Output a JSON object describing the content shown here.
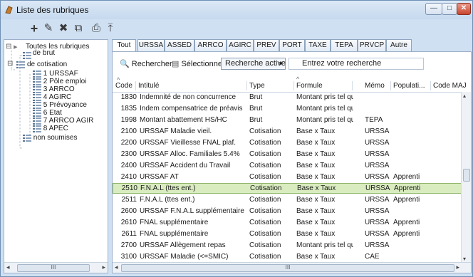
{
  "window": {
    "title": "Liste des rubriques",
    "min_icon": "—",
    "max_icon": "□",
    "close_icon": "✕"
  },
  "toolbar": [
    {
      "name": "add-icon",
      "glyph": "+"
    },
    {
      "name": "edit-icon",
      "glyph": "✎"
    },
    {
      "name": "delete-icon",
      "glyph": "✖"
    },
    {
      "name": "duplicate-icon",
      "glyph": "⧉"
    },
    {
      "name": "print-icon",
      "glyph": "⎙"
    },
    {
      "name": "export-icon",
      "glyph": "⤒"
    }
  ],
  "tree": {
    "expander_open": "⊟",
    "root": "Toutes les rubriques",
    "brut": "de brut",
    "cotisation": "de cotisation",
    "children": [
      "1 URSSAF",
      "2 Pôle emploi",
      "3 ARRCO",
      "4 AGIRC",
      "5 Prévoyance",
      "6 Etat",
      "7 ARRCO AGIR",
      "8 APEC"
    ],
    "non_soumises": "non soumises",
    "scroll_thumb": "III",
    "scroll_left": "◂",
    "scroll_right": "▸"
  },
  "tabs": [
    "Tout",
    "URSSA",
    "ASSED",
    "ARRCO",
    "AGIRC",
    "PREV",
    "PORT",
    "TAXE",
    "TEPA",
    "PRVCP",
    "Autre"
  ],
  "search": {
    "rechercher": "Rechercher",
    "selectionner": "Sélectionner",
    "mode": "Recherche active",
    "placeholder": "Entrez votre recherche",
    "dropdown_arrow": "▼",
    "search_glyph": "🔍",
    "select_glyph": "▤"
  },
  "columns": [
    "Code",
    "Intitulé",
    "Type",
    "Formule",
    "Mémo",
    "Populati...",
    "Code MAJ"
  ],
  "sort_indicator": "^",
  "rows": [
    {
      "code": "1830",
      "intitule": "Indemnité de non concurrence",
      "type": "Brut",
      "formule": "Montant pris tel quel",
      "memo": "",
      "population": "",
      "code_maj": ""
    },
    {
      "code": "1835",
      "intitule": "Indem compensatrice de préavis",
      "type": "Brut",
      "formule": "Montant pris tel quel",
      "memo": "",
      "population": "",
      "code_maj": ""
    },
    {
      "code": "1998",
      "intitule": "Montant abattement HS/HC",
      "type": "Brut",
      "formule": "Montant pris tel quel",
      "memo": "TEPA",
      "population": "",
      "code_maj": ""
    },
    {
      "code": "2100",
      "intitule": "URSSAF Maladie vieil.",
      "type": "Cotisation",
      "formule": "Base x Taux",
      "memo": "URSSA",
      "population": "",
      "code_maj": ""
    },
    {
      "code": "2200",
      "intitule": "URSSAF Vieillesse FNAL plaf.",
      "type": "Cotisation",
      "formule": "Base x Taux",
      "memo": "URSSA",
      "population": "",
      "code_maj": ""
    },
    {
      "code": "2300",
      "intitule": "URSSAF Alloc. Familiales 5.4%",
      "type": "Cotisation",
      "formule": "Base x Taux",
      "memo": "URSSA",
      "population": "",
      "code_maj": ""
    },
    {
      "code": "2400",
      "intitule": "URSSAF Accident du Travail",
      "type": "Cotisation",
      "formule": "Base x Taux",
      "memo": "URSSA",
      "population": "",
      "code_maj": ""
    },
    {
      "code": "2410",
      "intitule": "URSSAF AT",
      "type": "Cotisation",
      "formule": "Base x Taux",
      "memo": "URSSA",
      "population": "Apprenti",
      "code_maj": ""
    },
    {
      "code": "2510",
      "intitule": "F.N.A.L (ttes ent.)",
      "type": "Cotisation",
      "formule": "Base x Taux",
      "memo": "URSSA",
      "population": "Apprenti",
      "code_maj": ""
    },
    {
      "code": "2511",
      "intitule": "F.N.A.L (ttes ent.)",
      "type": "Cotisation",
      "formule": "Base x Taux",
      "memo": "URSSA",
      "population": "Apprenti",
      "code_maj": ""
    },
    {
      "code": "2600",
      "intitule": "URSSAF F.N.A.L supplémentaire",
      "type": "Cotisation",
      "formule": "Base x Taux",
      "memo": "URSSA",
      "population": "",
      "code_maj": ""
    },
    {
      "code": "2610",
      "intitule": "FNAL supplémentaire",
      "type": "Cotisation",
      "formule": "Base x Taux",
      "memo": "URSSA",
      "population": "Apprenti",
      "code_maj": ""
    },
    {
      "code": "2611",
      "intitule": "FNAL supplémentaire",
      "type": "Cotisation",
      "formule": "Base x Taux",
      "memo": "URSSA",
      "population": "Apprenti",
      "code_maj": ""
    },
    {
      "code": "2700",
      "intitule": "URSSAF Allègement repas",
      "type": "Cotisation",
      "formule": "Montant pris tel quel",
      "memo": "URSSA",
      "population": "",
      "code_maj": ""
    },
    {
      "code": "3100",
      "intitule": "URSSAF Maladie (<=SMIC)",
      "type": "Cotisation",
      "formule": "Base x Taux",
      "memo": "CAE",
      "population": "",
      "code_maj": ""
    }
  ],
  "selected_code": "2510",
  "table_scroll": {
    "up": "▴",
    "down": "▾",
    "left": "◂",
    "right": "▸",
    "thumb": "III"
  },
  "colors": {
    "selection_bg": "#d9ecbf",
    "selection_border": "#8fb56a",
    "window_bg": "#cfe0f2"
  }
}
